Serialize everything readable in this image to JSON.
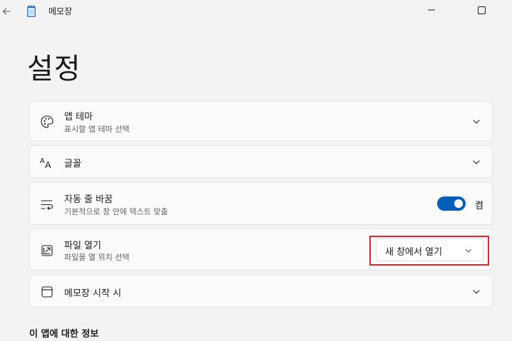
{
  "window": {
    "title": "메모장",
    "back_icon": "back-arrow-icon",
    "app_icon": "notepad-icon"
  },
  "page": {
    "title": "설정"
  },
  "settings": {
    "theme": {
      "label": "앱 테마",
      "description": "표시할 앱 테마 선택",
      "icon": "palette-icon"
    },
    "font": {
      "label": "글꼴",
      "icon": "font-icon"
    },
    "wordwrap": {
      "label": "자동 줄 바꿈",
      "description": "기본적으로 창 안에 텍스트 맞춤",
      "state_label": "켬",
      "enabled": true,
      "icon": "word-wrap-icon"
    },
    "open_file": {
      "label": "파일 열기",
      "description": "파일을 열 위치 선택",
      "selected_option": "새 창에서 열기",
      "icon": "open-file-icon"
    },
    "startup": {
      "label": "메모장 시작 시",
      "icon": "window-icon"
    }
  },
  "about": {
    "heading": "이 앱에 대한 정보"
  },
  "colors": {
    "accent": "#005fb8",
    "highlight_border": "#e0262f",
    "background": "#f3f3f3",
    "card": "#fbfbfb"
  }
}
